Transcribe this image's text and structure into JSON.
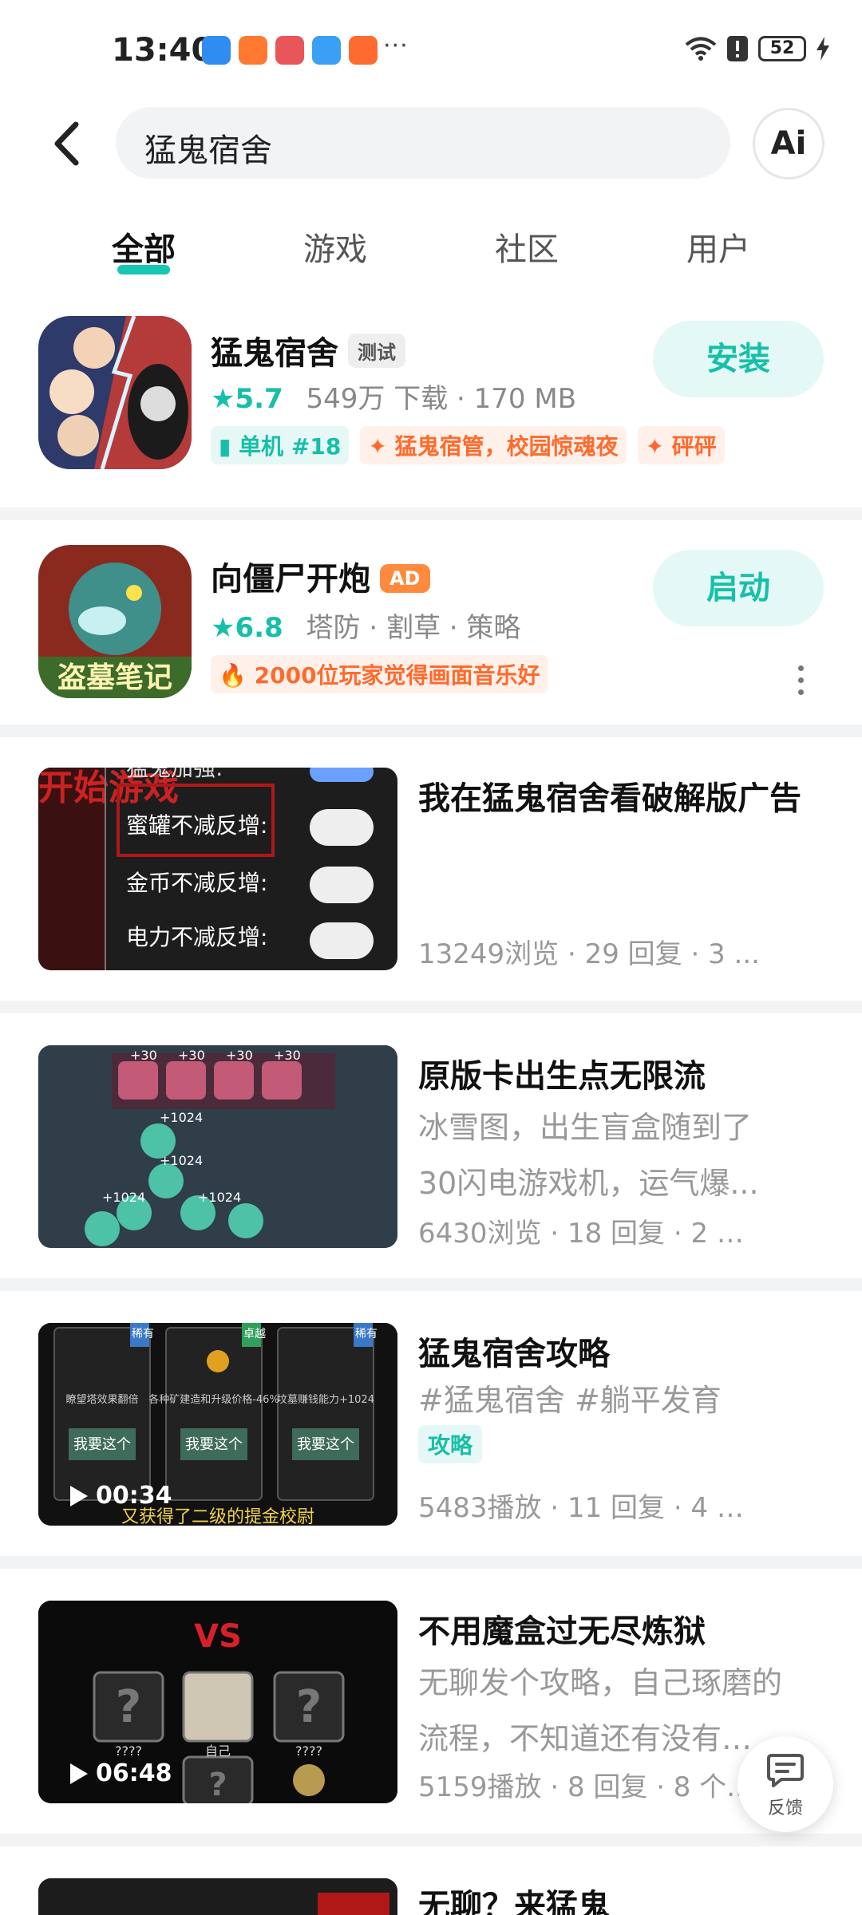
{
  "status_bar": {
    "time": "13:40",
    "battery": "52",
    "dots": "···"
  },
  "search": {
    "query": "猛鬼宿舍",
    "ai_label": "Ai"
  },
  "tabs": [
    {
      "label": "全部",
      "active": true
    },
    {
      "label": "游戏",
      "active": false
    },
    {
      "label": "社区",
      "active": false
    },
    {
      "label": "用户",
      "active": false
    }
  ],
  "apps": [
    {
      "name": "猛鬼宿舍",
      "badge": "测试",
      "rating": "5.7",
      "meta": "549万 下载 · 170 MB",
      "tags": [
        "单机 #18",
        "猛鬼宿管，校园惊魂夜",
        "砰砰"
      ],
      "action": "安装"
    },
    {
      "name": "向僵尸开炮",
      "badge": "AD",
      "rating": "6.8",
      "meta": "塔防 · 割草 · 策略",
      "tags": [
        "2000位玩家觉得画面音乐好"
      ],
      "icon_text": "盗墓笔记",
      "action": "启动"
    }
  ],
  "posts": [
    {
      "title": "我在猛鬼宿舍看破解版广告",
      "stats": "13249浏览 · 29 回复 · 3 ...",
      "thumb_lines": [
        "猛鬼加强:",
        "蜜罐不减反增:",
        "金币不减反增:",
        "电力不减反增:"
      ],
      "thumb_bg_text": "开始游戏"
    },
    {
      "title": "原版卡出生点无限流",
      "line1": "冰雪图，出生盲盒随到了",
      "line2": "30闪电游戏机，运气爆...",
      "stats": "6430浏览 · 18 回复 · 2 个...",
      "thumb_texts": [
        "+30",
        "+30",
        "+30",
        "+30",
        "+1024",
        "+1024",
        "+1024",
        "+1024"
      ]
    },
    {
      "title": "猛鬼宿舍攻略",
      "line1": "#猛鬼宿舍 #躺平发育",
      "tag": "攻略",
      "stats": "5483播放 · 11 回复 · 4 个...",
      "duration": "00:34",
      "cards": [
        {
          "corner": "稀有",
          "desc": "瞭望塔效果翻倍",
          "btn": "我要这个"
        },
        {
          "corner": "卓越",
          "desc": "各种矿建造和升级价格-46%",
          "btn": "我要这个"
        },
        {
          "corner": "稀有",
          "desc": "坟墓赚钱能力+1024",
          "btn": "我要这个"
        }
      ],
      "subtitle": "又获得了二级的提金校尉"
    },
    {
      "title": "不用魔盒过无尽炼狱",
      "line1": "无聊发个攻略，自己琢磨的",
      "line2": "流程，不知道还有没有优...",
      "stats": "5159播放 · 8 回复 · 8 个...",
      "duration": "06:48",
      "vs": "VS",
      "qmarks": [
        "?",
        "?",
        "?"
      ],
      "labels": [
        "????",
        "自己",
        "????"
      ]
    },
    {
      "title": "无聊？来猛鬼"
    }
  ],
  "feedback": {
    "label": "反馈"
  },
  "colors": {
    "accent": "#17bfa9",
    "orange": "#ff6a2c",
    "separator": "#f2f3f5"
  }
}
